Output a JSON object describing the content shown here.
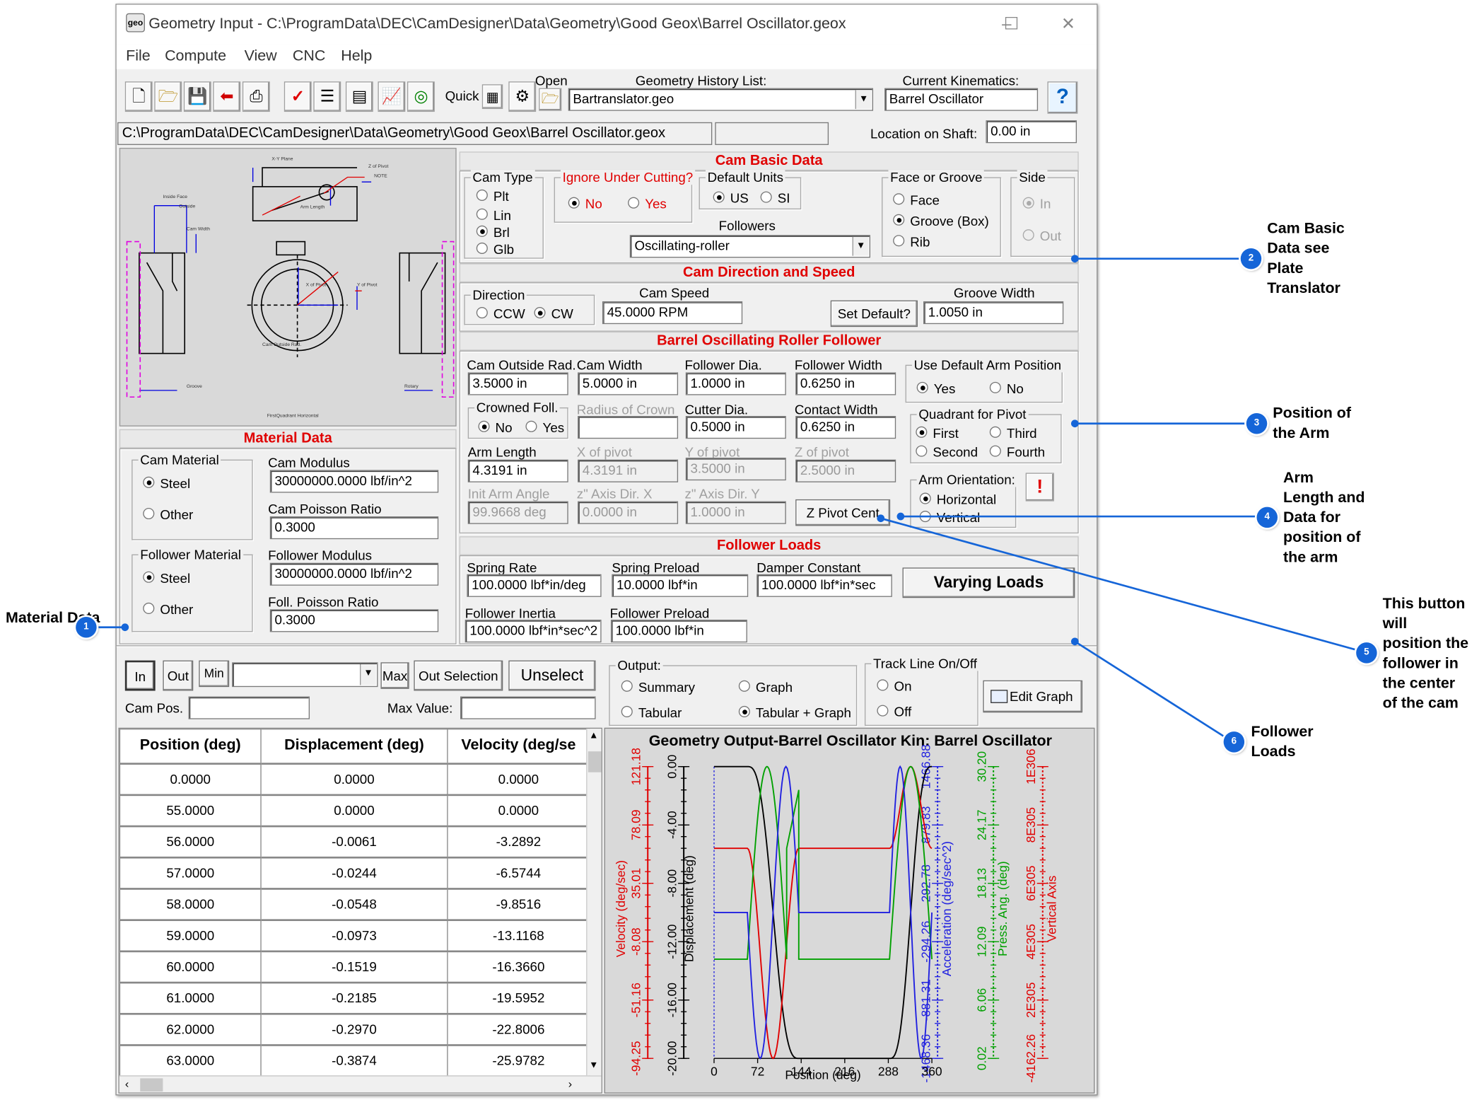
{
  "window": {
    "title": "Geometry Input - C:\\ProgramData\\DEC\\CamDesigner\\Data\\Geometry\\Good Geox\\Barrel Oscillator.geox",
    "icon_text": "geo",
    "menu": [
      "File",
      "Compute",
      "View",
      "CNC",
      "Help"
    ]
  },
  "toolbar": {
    "quick_label": "Quick",
    "open_label": "Open",
    "history_label": "Geometry History List:",
    "history_value": "Bartranslator.geo",
    "kin_label": "Current Kinematics:",
    "kin_value": "Barrel Oscillator",
    "help_glyph": "?",
    "path": "C:\\ProgramData\\DEC\\CamDesigner\\Data\\Geometry\\Good Geox\\Barrel Oscillator.geox",
    "location_label": "Location on Shaft:",
    "location_value": "0.00 in"
  },
  "material": {
    "header": "Material Data",
    "cam_group": "Cam Material",
    "cam_steel": "Steel",
    "cam_other": "Other",
    "cam_mod_label": "Cam Modulus",
    "cam_mod": "30000000.0000 lbf/in^2",
    "cam_pois_label": "Cam Poisson Ratio",
    "cam_pois": "0.3000",
    "fol_group": "Follower Material",
    "fol_steel": "Steel",
    "fol_other": "Other",
    "fol_mod_label": "Follower Modulus",
    "fol_mod": "30000000.0000 lbf/in^2",
    "fol_pois_label": "Foll. Poisson Ratio",
    "fol_pois": "0.3000"
  },
  "basic": {
    "header": "Cam Basic Data",
    "type_group": "Cam Type",
    "plt": "Plt",
    "lin": "Lin",
    "brl": "Brl",
    "glb": "Glb",
    "ignore_group": "Ignore Under Cutting?",
    "no": "No",
    "yes": "Yes",
    "units_group": "Default Units",
    "us": "US",
    "si": "SI",
    "followers_label": "Followers",
    "followers_value": "Oscillating-roller",
    "face_group": "Face or Groove",
    "face": "Face",
    "groove": "Groove (Box)",
    "rib": "Rib",
    "side_group": "Side",
    "in": "In",
    "out": "Out"
  },
  "direction": {
    "header": "Cam Direction and Speed",
    "dir_group": "Direction",
    "ccw": "CCW",
    "cw": "CW",
    "speed_label": "Cam Speed",
    "speed": "45.0000 RPM",
    "set_default": "Set Default?",
    "groove_label": "Groove Width",
    "groove": "1.0050 in"
  },
  "follower": {
    "header": "Barrel Oscillating Roller Follower",
    "outside_rad_label": "Cam Outside Rad.",
    "outside_rad": "3.5000 in",
    "cam_width_label": "Cam Width",
    "cam_width": "5.0000 in",
    "fol_dia_label": "Follower Dia.",
    "fol_dia": "1.0000 in",
    "fol_width_label": "Follower Width",
    "fol_width": "0.6250 in",
    "default_arm_group": "Use Default Arm Position",
    "yes": "Yes",
    "no": "No",
    "crowned_group": "Crowned Foll.",
    "c_no": "No",
    "c_yes": "Yes",
    "crown_rad_label": "Radius of Crown",
    "crown_rad": "",
    "cutter_label": "Cutter Dia.",
    "cutter": "0.5000 in",
    "contact_label": "Contact Width",
    "contact": "0.6250 in",
    "quadrant_group": "Quadrant for Pivot",
    "first": "First",
    "third": "Third",
    "second": "Second",
    "fourth": "Fourth",
    "arm_len_label": "Arm Length",
    "arm_len": "4.3191 in",
    "xpiv_label": "X of pivot",
    "xpiv": "4.3191 in",
    "ypiv_label": "Y of pivot",
    "ypiv": "3.5000 in",
    "zpiv_label": "Z of pivot",
    "zpiv": "2.5000 in",
    "orient_group": "Arm Orientation:",
    "horizontal": "Horizontal",
    "vertical": "Vertical",
    "init_label": "Init Arm Angle",
    "init": "99.9668 deg",
    "zx_label": "z\" Axis Dir. X",
    "zx": "0.0000 in",
    "zy_label": "z\" Axis Dir. Y",
    "zy": "1.0000 in",
    "zpivot_btn": "Z Pivot Cent"
  },
  "loads": {
    "header": "Follower Loads",
    "spring_rate_label": "Spring Rate",
    "spring_rate": "100.0000 lbf*in/deg",
    "spring_pre_label": "Spring Preload",
    "spring_pre": "10.0000 lbf*in",
    "damper_label": "Damper Constant",
    "damper": "100.0000 lbf*in*sec",
    "varying_btn": "Varying Loads",
    "inertia_label": "Follower Inertia",
    "inertia": "100.0000 lbf*in*sec^2",
    "fol_pre_label": "Follower Preload",
    "fol_pre": "100.0000 lbf*in"
  },
  "controls": {
    "in": "In",
    "out": "Out",
    "min": "Min",
    "max": "Max",
    "out_selection": "Out Selection",
    "unselect": "Unselect",
    "cam_pos_label": "Cam Pos.",
    "max_value_label": "Max Value:",
    "output_group": "Output:",
    "summary": "Summary",
    "graph": "Graph",
    "tabular": "Tabular",
    "tab_graph": "Tabular + Graph",
    "track_group": "Track Line On/Off",
    "on": "On",
    "off": "Off",
    "edit_graph": "Edit Graph"
  },
  "table": {
    "headers": [
      "Position (deg)",
      "Displacement (deg)",
      "Velocity (deg/se"
    ],
    "rows": [
      [
        "0.0000",
        "0.0000",
        "0.0000"
      ],
      [
        "55.0000",
        "0.0000",
        "0.0000"
      ],
      [
        "56.0000",
        "-0.0061",
        "-3.2892"
      ],
      [
        "57.0000",
        "-0.0244",
        "-6.5744"
      ],
      [
        "58.0000",
        "-0.0548",
        "-9.8516"
      ],
      [
        "59.0000",
        "-0.0973",
        "-13.1168"
      ],
      [
        "60.0000",
        "-0.1519",
        "-16.3660"
      ],
      [
        "61.0000",
        "-0.2185",
        "-19.5952"
      ],
      [
        "62.0000",
        "-0.2970",
        "-22.8006"
      ],
      [
        "63.0000",
        "-0.3874",
        "-25.9782"
      ]
    ]
  },
  "chart_data": {
    "type": "line",
    "title": "Geometry Output-Barrel Oscillator Kin: Barrel Oscillator",
    "xlabel": "Position (deg)",
    "x_ticks": [
      "0",
      "72",
      "144",
      "216",
      "288",
      "360"
    ],
    "xlim": [
      0,
      360
    ],
    "axes": [
      {
        "label": "Velocity (deg/sec)",
        "color": "#e00000",
        "ticks": [
          "-94.25",
          "-51.16",
          "-8.08",
          "35.01",
          "78.09",
          "121.18"
        ]
      },
      {
        "label": "Displacement (deg)",
        "color": "#000000",
        "ticks": [
          "-20.00",
          "-16.00",
          "-12.00",
          "-8.00",
          "-4.00",
          "0.00"
        ]
      },
      {
        "label": "Acceleration (deg/sec^2)",
        "color": "#2020e0",
        "ticks": [
          "-1468.36",
          "-881.31",
          "-294.26",
          "292.78",
          "879.83",
          "1466.88"
        ]
      },
      {
        "label": "Press. Ang. (deg)",
        "color": "#00a000",
        "ticks": [
          "0.02",
          "6.06",
          "12.09",
          "18.13",
          "24.17",
          "30.20"
        ]
      },
      {
        "label": "Vertical Axis",
        "color": "#e00000",
        "ticks": [
          "-4162.26",
          "2E305",
          "4E305",
          "6E305",
          "8E305",
          "1E306"
        ]
      }
    ],
    "grid": false
  },
  "annotations": [
    {
      "n": "1",
      "text": "Material\nData"
    },
    {
      "n": "2",
      "text": "Cam Basic\nData see\nPlate\nTranslator"
    },
    {
      "n": "3",
      "text": "Position of\nthe Arm"
    },
    {
      "n": "4",
      "text": "Arm\nLength and\nData for\nposition of\nthe arm"
    },
    {
      "n": "5",
      "text": "This button\nwill\nposition the\nfollower in\nthe center\nof the cam"
    },
    {
      "n": "6",
      "text": "Follower\nLoads"
    }
  ]
}
